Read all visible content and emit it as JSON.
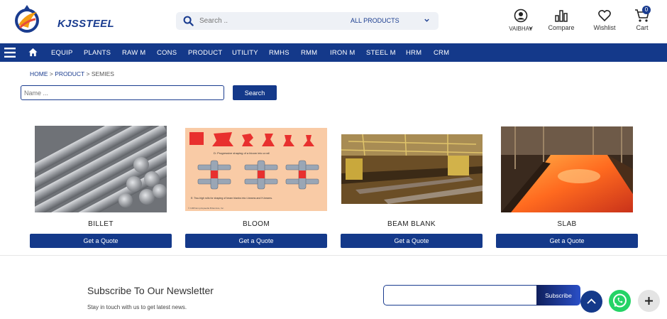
{
  "brand": {
    "name": "KJSSTEEL"
  },
  "search": {
    "placeholder": "Search ..",
    "category": "ALL PRODUCTS"
  },
  "header_icons": {
    "account": "VAIBHAV",
    "compare": "Compare",
    "wishlist": "Wishlist",
    "cart": "Cart",
    "cart_count": "0"
  },
  "nav": {
    "items": [
      "EQUIP",
      "PLANTS",
      "RAW M",
      "CONS",
      "PRODUCT",
      "UTILITY",
      "RMHS",
      "RMM",
      "IRON M",
      "STEEL M",
      "HRM",
      "CRM"
    ]
  },
  "breadcrumb": {
    "home": "HOME",
    "sep1": ">",
    "product": "PRODUCT",
    "sep2": ">",
    "current": "SEMIES"
  },
  "filter": {
    "name_placeholder": "Name ...",
    "search_label": "Search"
  },
  "products": [
    {
      "title": "BILLET",
      "button": "Get a Quote"
    },
    {
      "title": "BLOOM",
      "button": "Get a Quote"
    },
    {
      "title": "BEAM BLANK",
      "button": "Get a Quote"
    },
    {
      "title": "SLAB",
      "button": "Get a Quote"
    }
  ],
  "bloom_diagram": {
    "caption_d": "D: Progressive shaping of a bloom into a rail",
    "caption_e": "E: Two-high rolls for shaping of beam blanks into I-beams and H-beams.",
    "copyright": "© 1995 Encyclopaedia Britannica, Inc."
  },
  "newsletter": {
    "title": "Subscribe To Our Newsletter",
    "subtitle": "Stay in touch with us to get latest news.",
    "button": "Subscribe"
  },
  "colors": {
    "brand_blue": "#14398a",
    "whatsapp": "#25d366"
  },
  "icons": [
    "search-icon",
    "chevron-down-icon",
    "user-icon",
    "compare-icon",
    "heart-icon",
    "cart-icon",
    "menu-icon",
    "home-icon",
    "chevron-up-icon",
    "whatsapp-icon",
    "plus-icon"
  ]
}
